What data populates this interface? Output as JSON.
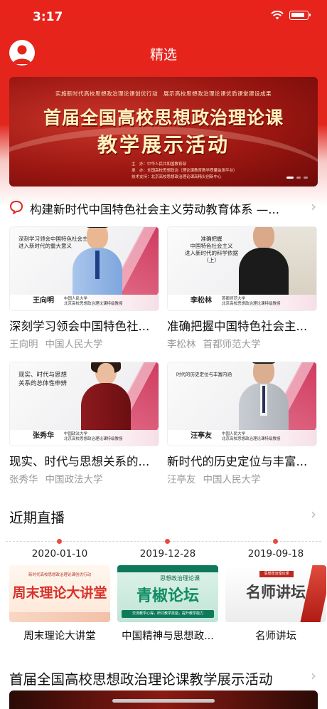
{
  "status_bar": {
    "time": "3:17"
  },
  "nav": {
    "title": "精选"
  },
  "banner": {
    "subtitle": "实施新时代高校思想政治理论课创优行动　展示高校思想政治理论课优质课堂建设成果",
    "title_line1": "首届全国高校思想政治理论课",
    "title_line2": "教学展示活动",
    "info_lines": [
      "主　办：中华人民共和国教育部",
      "承　办：全国高校思想政治（理论课教育教学质量监测平台）",
      "技术支持：北京高校思想政治理论课高精尖创新中心"
    ],
    "active_slide": 0,
    "slide_count": 3
  },
  "announcement": {
    "text": "构建新时代中国特色社会主义劳动教育体系 —..."
  },
  "videos": [
    {
      "thumb_topic": [
        "深刻学习领会中国特色社会主义",
        "进入新时代的重大意义"
      ],
      "thumb_speaker": "王向明",
      "thumb_org": [
        "中国人民大学",
        "北京高校思想政治理论课特级教授"
      ],
      "title": "深刻学习领会中国特色社...",
      "speaker": "王向明",
      "org": "中国人民大学"
    },
    {
      "thumb_topic": [
        "准确把握",
        "中国特色社会主义",
        "进入新时代的科学依据",
        "（上）"
      ],
      "thumb_speaker": "李松林",
      "thumb_org": [
        "首都师范大学",
        "北京高校思想政治理论课特级教授"
      ],
      "title": "准确把握中国特色社会主...",
      "speaker": "李松林",
      "org": "首都师范大学"
    },
    {
      "thumb_topic": [
        "现实、时代与思想",
        "关系的总体性申辨"
      ],
      "thumb_speaker": "张秀华",
      "thumb_org": [
        "中国政法大学",
        "北京高校思想政治理论课特级教授"
      ],
      "title": "现实、时代与思想关系的...",
      "speaker": "张秀华",
      "org": "中国政法大学"
    },
    {
      "thumb_topic": [
        "时代的历史定位与丰富内涵"
      ],
      "thumb_speaker": "汪亭友",
      "thumb_org": [
        "中国人民大学",
        "北京高校思想政治理论课特级教授"
      ],
      "title": "新时代的历史定位与丰富...",
      "speaker": "汪亭友",
      "org": "中国人民大学"
    }
  ],
  "live": {
    "title": "近期直播",
    "items": [
      {
        "date": "2020-01-10",
        "name": "周末理论大讲堂",
        "thumb_text": "周末理论大讲堂",
        "thumb_caption": "新时代高校思想政治理论课创优行动"
      },
      {
        "date": "2019-12-28",
        "name": "中国精神与思想政...",
        "thumb_text": "青椒论坛",
        "thumb_caption": "思想政治理论课",
        "thumb_slogan": "交流教学心得，研讨教学技能，提升教学能力"
      },
      {
        "date": "2019-09-18",
        "name": "名师讲坛",
        "thumb_text": "名师讲坛",
        "thumb_caption": "思想政治理论课"
      }
    ]
  },
  "activity": {
    "title": "首届全国高校思想政治理论课教学展示活动"
  },
  "colors": {
    "brand_red": "#e2261d",
    "accent_pink": "#c9204a",
    "timeline_dot": "#e74b3c"
  },
  "icons": {
    "avatar": "avatar-icon",
    "announcement": "speech-bubble-icon",
    "more": "chevron-right-icon"
  }
}
